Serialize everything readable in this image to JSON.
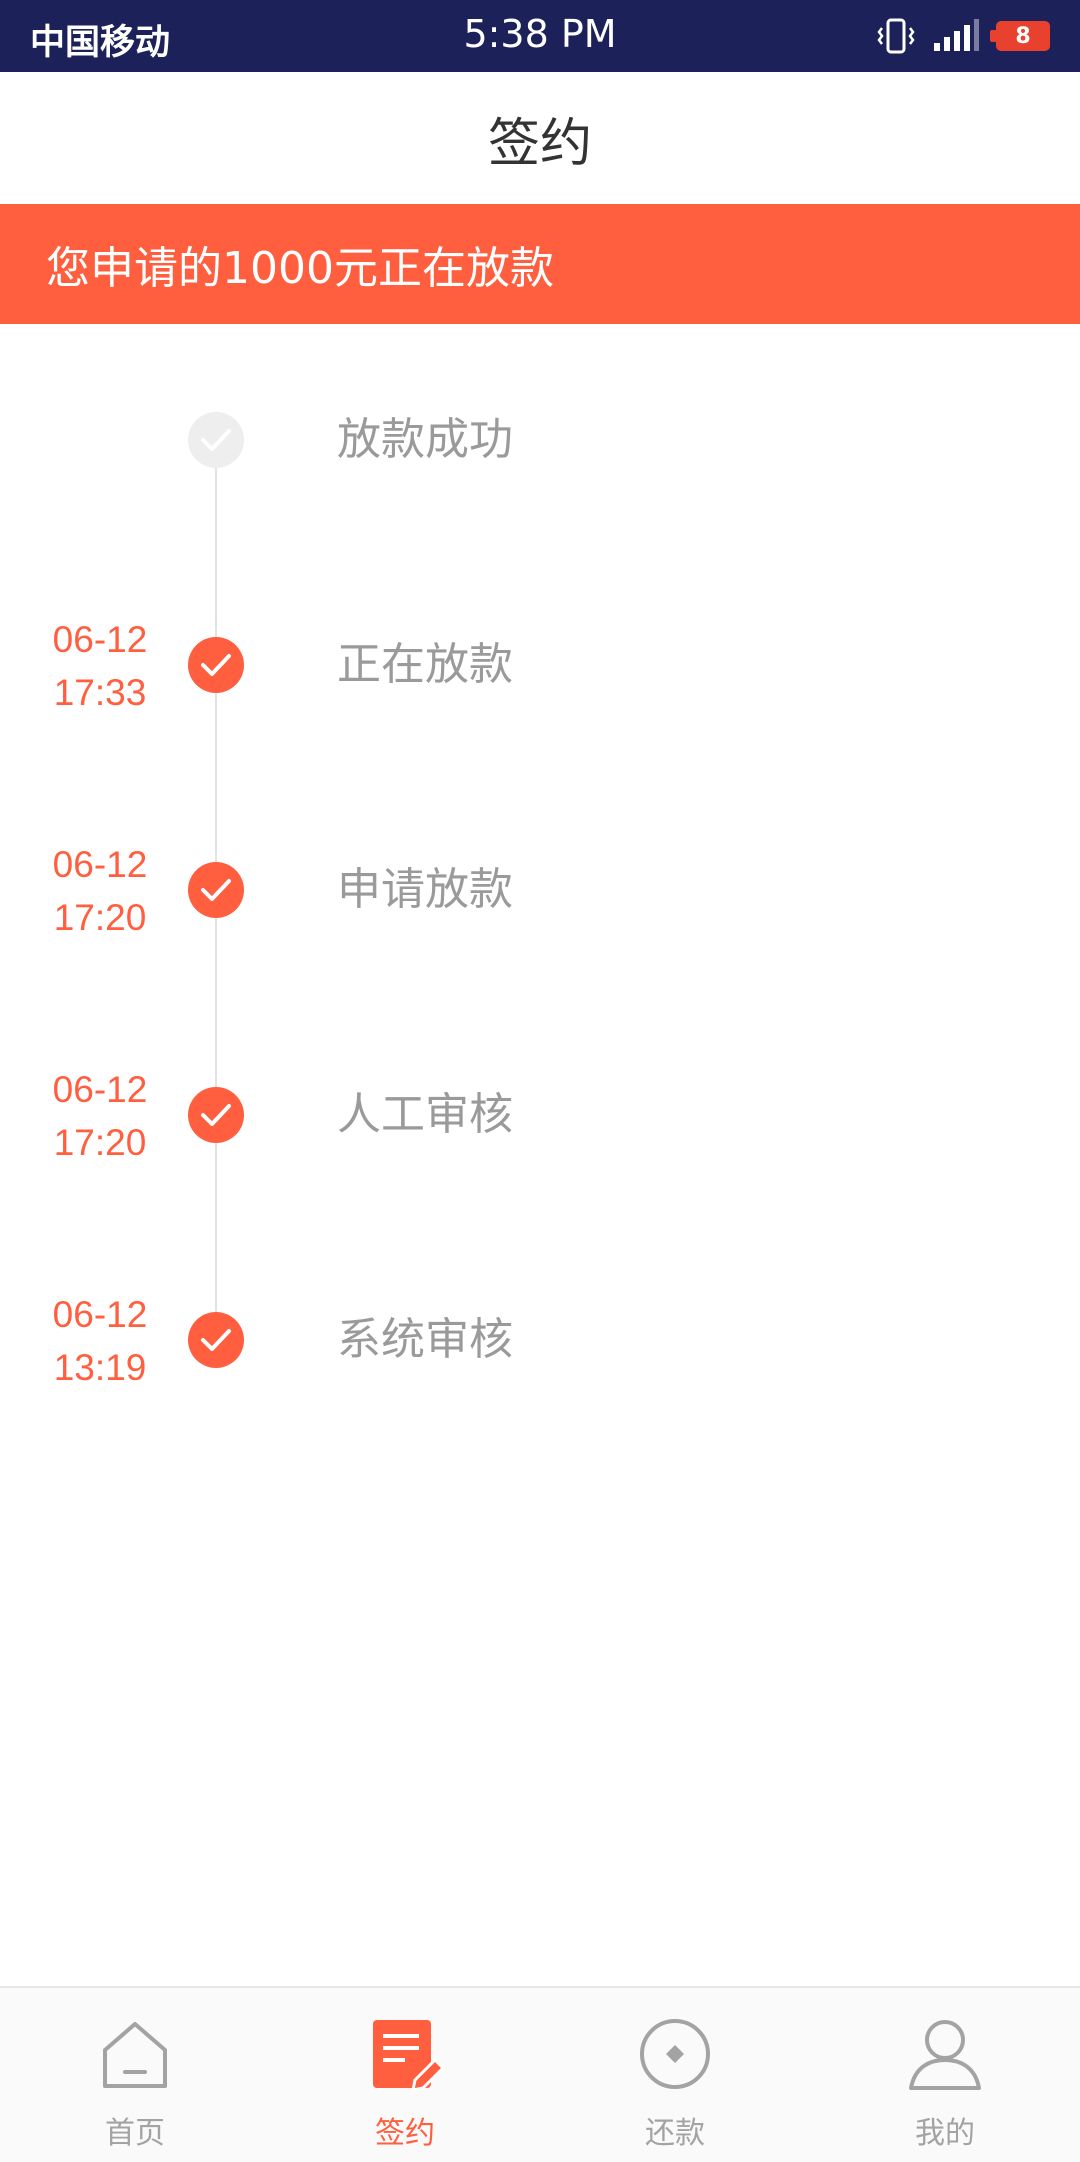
{
  "status_bar": {
    "carrier": "中国移动",
    "time": "5:38 PM",
    "battery": "8"
  },
  "header": {
    "title": "签约"
  },
  "banner": {
    "text": "您申请的1000元正在放款"
  },
  "timeline": [
    {
      "label": "放款成功",
      "date": "",
      "time": "",
      "done": false
    },
    {
      "label": "正在放款",
      "date": "06-12",
      "time": "17:33",
      "done": true
    },
    {
      "label": "申请放款",
      "date": "06-12",
      "time": "17:20",
      "done": true
    },
    {
      "label": "人工审核",
      "date": "06-12",
      "time": "17:20",
      "done": true
    },
    {
      "label": "系统审核",
      "date": "06-12",
      "time": "13:19",
      "done": true
    }
  ],
  "tabbar": {
    "tabs": [
      {
        "label": "首页",
        "icon": "home-icon",
        "active": false
      },
      {
        "label": "签约",
        "icon": "sign-document-icon",
        "active": true
      },
      {
        "label": "还款",
        "icon": "repay-coin-icon",
        "active": false
      },
      {
        "label": "我的",
        "icon": "user-profile-icon",
        "active": false
      }
    ]
  },
  "colors": {
    "accent": "#ff5e3f",
    "status_bar_bg": "#1d2159",
    "inactive": "#a3a3a3"
  }
}
